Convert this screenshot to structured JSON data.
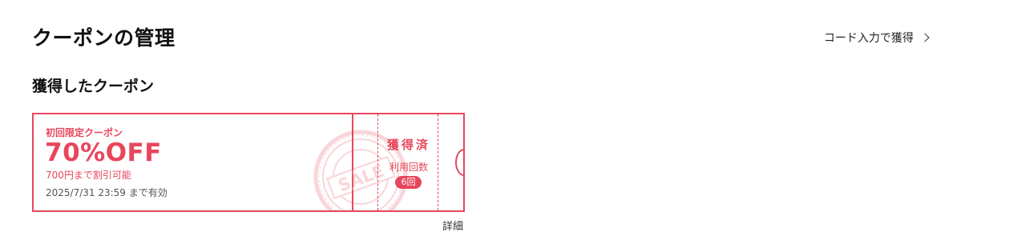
{
  "header": {
    "title": "クーポンの管理",
    "code_link_label": "コード入力で獲得"
  },
  "section": {
    "title": "獲得したクーポン"
  },
  "coupons": [
    {
      "label": "初回限定クーポン",
      "discount": "70%OFF",
      "condition": "700円まで割引可能",
      "expiry": "2025/7/31 23:59 まで有効",
      "stamp_text": "SALE",
      "status": "獲得済",
      "usage_label": "利用回数",
      "usage_count": "6回",
      "accent_color": "#e8465c"
    }
  ],
  "footer": {
    "detail_link_label": "詳細"
  },
  "icons": {
    "code_link_chevron": "chevron-right-icon"
  }
}
